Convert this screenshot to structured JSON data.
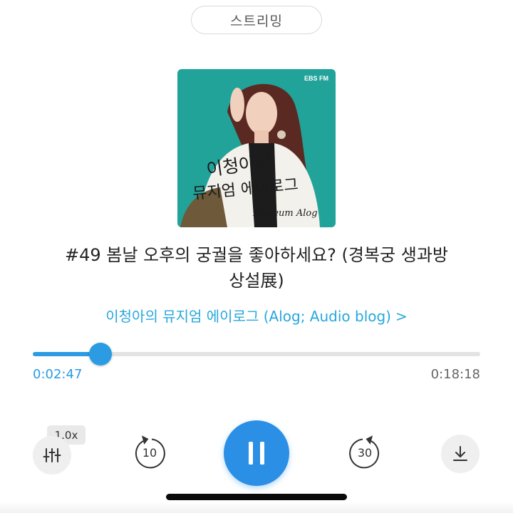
{
  "mode_label": "스트리밍",
  "cover": {
    "brand": "EBS FM",
    "title_line1": "이청아의",
    "title_line2": "뮤지엄 에이로그",
    "subtitle": "Museum Alog",
    "bg_color": "#21a39a"
  },
  "episode_title_line1": "#49 봄날 오후의 궁궐을 좋아하세요? (경복궁 생과방",
  "episode_title_line2": "상설展)",
  "program_name": "이청아의 뮤지엄 에이로그 (Alog; Audio blog)",
  "program_chevron": ">",
  "progress": {
    "elapsed": "0:02:47",
    "total": "0:18:18",
    "fraction": 0.152
  },
  "controls": {
    "speed": "1.0x",
    "rewind_seconds": "10",
    "forward_seconds": "30"
  },
  "colors": {
    "accent": "#2b8fe6",
    "link": "#27a7dd"
  }
}
